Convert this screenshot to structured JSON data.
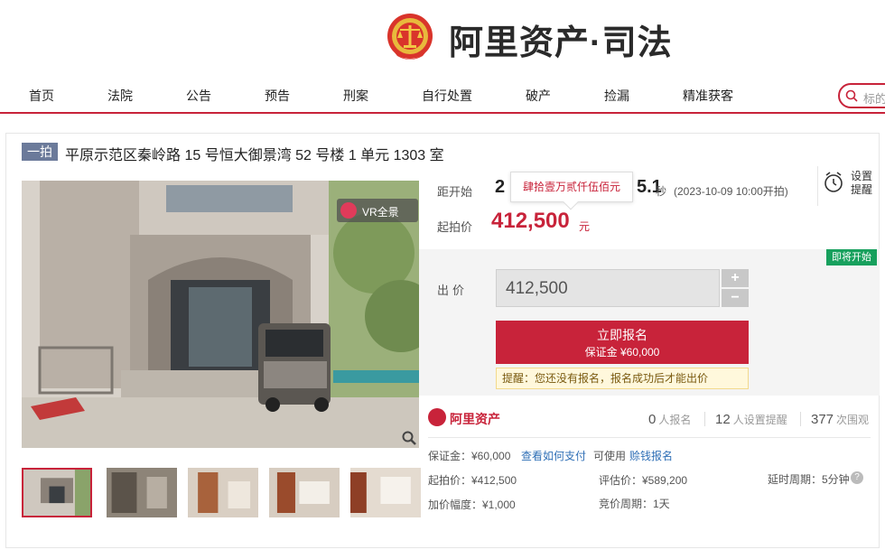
{
  "header": {
    "brand": "阿里资产·司法"
  },
  "nav": {
    "items": [
      "首页",
      "法院",
      "公告",
      "预告",
      "刑案",
      "自行处置",
      "破产",
      "捡漏",
      "精准获客"
    ],
    "search_placeholder": "标的"
  },
  "auction": {
    "badge": "一拍",
    "title": "平原示范区秦岭路 15 号恒大御景湾 52 号楼 1 单元 1303 室",
    "vr_label": "VR全景",
    "countdown_label": "距开始",
    "countdown_value": "2…………5.1",
    "countdown_visible_prefix": "2",
    "countdown_visible_suffix": "5.1",
    "countdown_sec_unit": "秒",
    "start_time": "(2023-10-09 10:00开拍)",
    "tooltip": "肆拾壹万贰仟伍佰元",
    "reminder": {
      "line1": "设置",
      "line2": "提醒"
    },
    "start_price_label": "起拍价",
    "start_price": "412,500",
    "start_price_unit": "元",
    "status": "即将开始",
    "bid_label": "出价",
    "bid_value": "412,500",
    "plus": "+",
    "minus": "−",
    "register_label": "立即报名",
    "deposit_line": "保证金 ¥60,000",
    "hint": "提醒：您还没有报名，报名成功后才能出价"
  },
  "stats": {
    "brand": "阿里资产",
    "registered_count": "0",
    "registered_label": "人报名",
    "reminder_count": "12",
    "reminder_label": "人设置提醒",
    "views_count": "377",
    "views_label": "次围观"
  },
  "details": {
    "deposit": "保证金：¥60,000",
    "how_to_pay": "查看如何支付",
    "can_use": "可使用",
    "zero_deposit": "赊钱报名",
    "start_price": "起拍价：¥412,500",
    "appraisal": "评估价：¥589,200",
    "delay": "延时周期：5分钟",
    "help": "?",
    "increment": "加价幅度：¥1,000",
    "cycle": "竞价周期：1天"
  },
  "colors": {
    "accent": "#c8233a",
    "status": "#17a05d",
    "link": "#2f6fb6"
  }
}
